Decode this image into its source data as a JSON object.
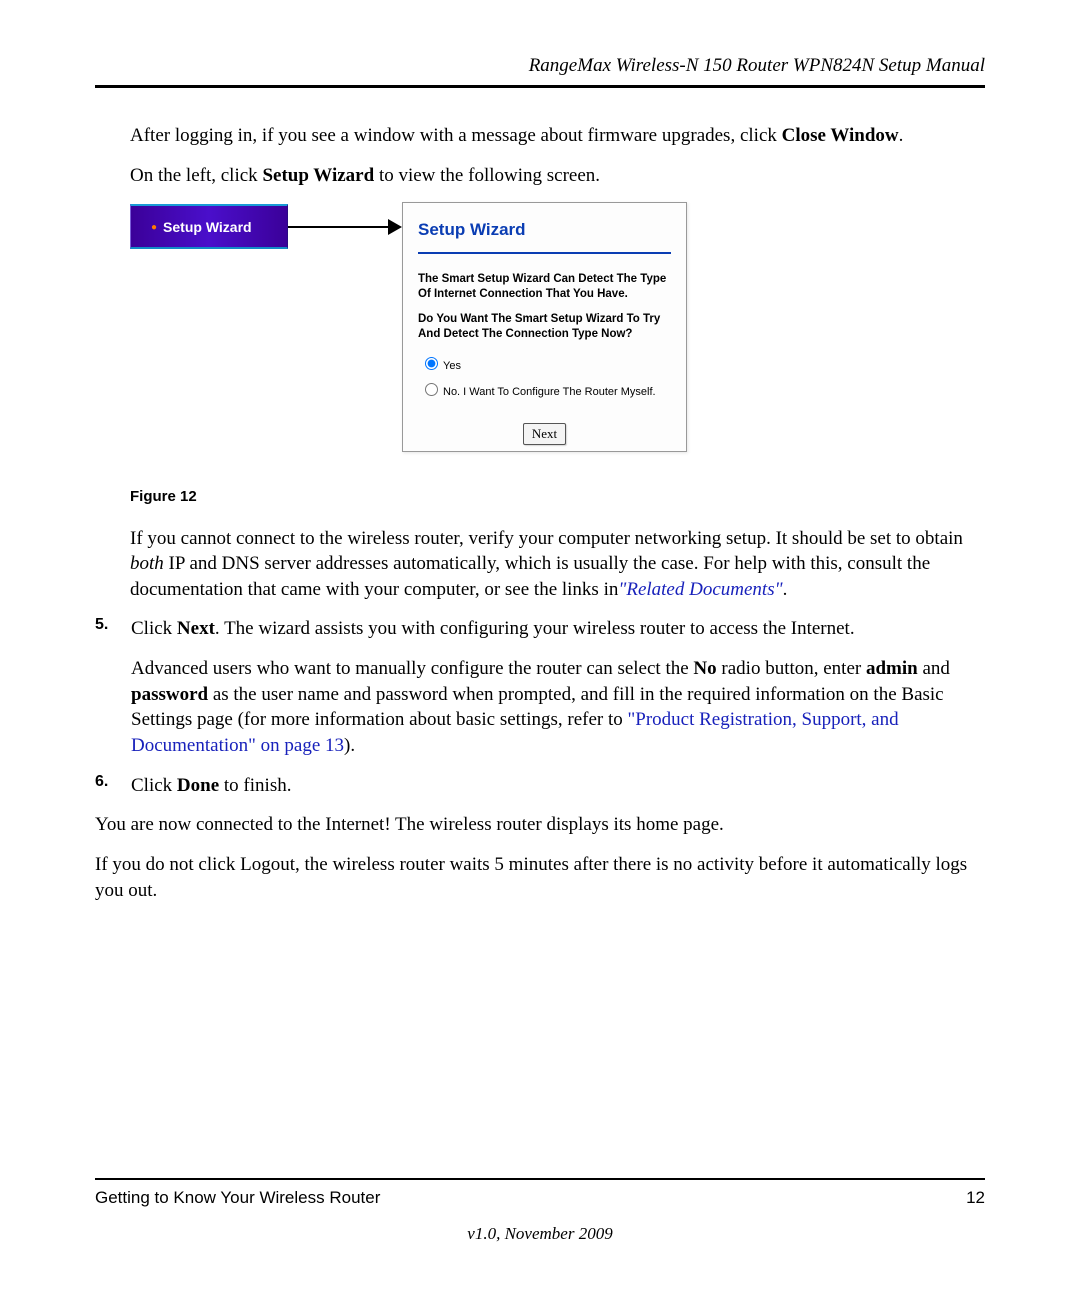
{
  "header": {
    "title": "RangeMax Wireless-N 150 Router WPN824N Setup Manual"
  },
  "body": {
    "p1a": "After logging in, if you see a window with a message about firmware upgrades, click ",
    "p1b": "Close Window",
    "p1c": ".",
    "p2a": "On the left, click ",
    "p2b": "Setup Wizard",
    "p2c": " to view the following screen."
  },
  "figure": {
    "menu_label": "Setup Wizard",
    "panel_title": "Setup Wizard",
    "text1": "The Smart Setup Wizard Can Detect The Type Of Internet Connection That You Have.",
    "text2": "Do You Want The Smart Setup Wizard To Try And Detect The Connection Type Now?",
    "radio_yes": "Yes",
    "radio_no": "No. I Want To Configure The Router Myself.",
    "next_label": "Next",
    "caption": "Figure 12"
  },
  "body2": {
    "p3a": "If you cannot connect to the wireless router, verify your computer networking setup. It should be set to obtain ",
    "p3b": "both",
    "p3c": " IP and DNS server addresses automatically, which is usually the case. For help with this, consult the documentation that came with your computer, or see the links in",
    "p3link": "\"Related Documents\"",
    "p3d": "."
  },
  "steps": {
    "s5_num": "5.",
    "s5a": "Click ",
    "s5b": "Next",
    "s5c": ". The wizard assists you with configuring your wireless router to access the Internet.",
    "s5_p2a": "Advanced users who want to manually configure the router can select the ",
    "s5_p2b": "No",
    "s5_p2c": " radio button, enter ",
    "s5_p2d": "admin",
    "s5_p2e": " and ",
    "s5_p2f": "password",
    "s5_p2g": " as the user name and password when prompted, and fill in the required information on the Basic Settings page (for more information about basic settings, refer to ",
    "s5_link": "\"Product Registration, Support, and Documentation\" on page 13",
    "s5_p2h": ").",
    "s6_num": "6.",
    "s6a": "Click ",
    "s6b": "Done",
    "s6c": " to finish."
  },
  "body3": {
    "p5": "You are now connected to the Internet! The wireless router displays its home page.",
    "p6": "If you do not click Logout, the wireless router waits 5 minutes after there is no activity before it automatically logs you out."
  },
  "footer": {
    "section": "Getting to Know Your Wireless Router",
    "page": "12",
    "version": "v1.0, November 2009"
  }
}
